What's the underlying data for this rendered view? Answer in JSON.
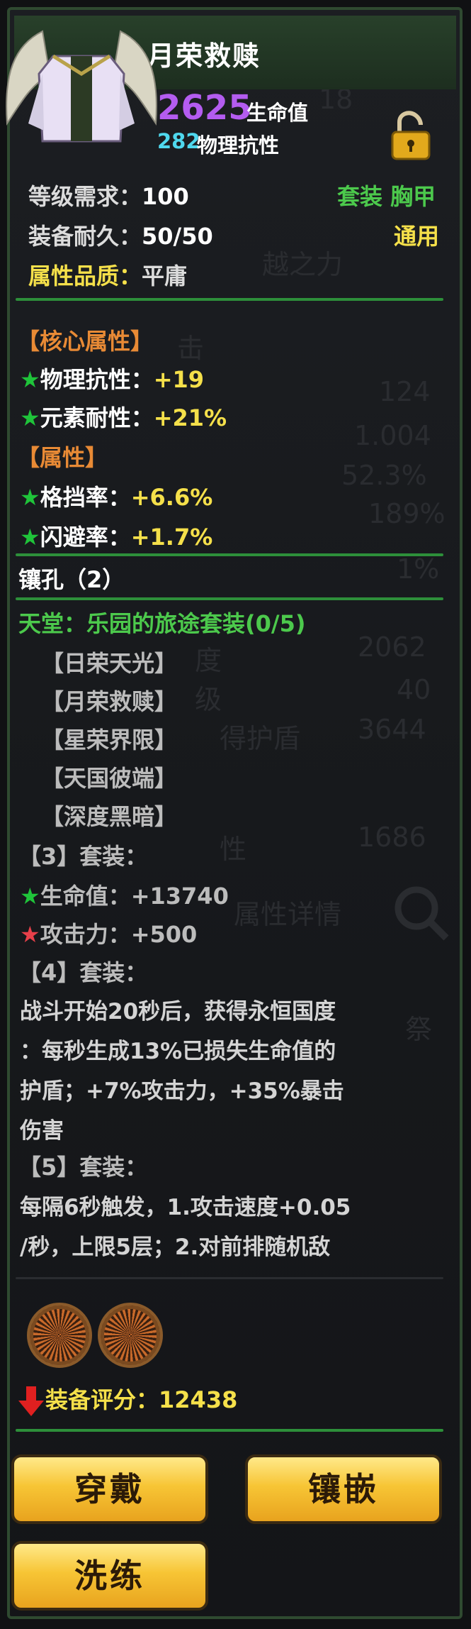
{
  "header": {
    "title": "月荣救赎",
    "hp_value": "2625",
    "hp_label": "生命值",
    "defense_value": "282",
    "defense_label": "物理抗性",
    "item_icon": "winged-armor-icon",
    "lock_icon": "unlocked-padlock-icon"
  },
  "info": {
    "level_label": "等级需求：",
    "level_value": "100",
    "type_label": "套装 胸甲",
    "durability_label": "装备耐久：",
    "durability_value": "50/50",
    "usage_label": "通用",
    "quality_label": "属性品质：",
    "quality_value": "平庸"
  },
  "core": {
    "header": "【核心属性】",
    "stats": [
      {
        "name": "物理抗性：",
        "value": "+19"
      },
      {
        "name": "元素耐性：",
        "value": "+21%"
      }
    ]
  },
  "attrs": {
    "header": "【属性】",
    "stats": [
      {
        "name": "格挡率：",
        "value": "+6.6%"
      },
      {
        "name": "闪避率：",
        "value": "+1.7%"
      }
    ]
  },
  "sockets": {
    "label": "镶孔（2）",
    "count": 2
  },
  "set": {
    "name": "天堂：乐园的旅途套装(0/5)",
    "pieces": [
      "【日荣天光】",
      "【月荣救赎】",
      "【星荣界限】",
      "【天国彼端】",
      "【深度黑暗】"
    ],
    "bonus3_label": "【3】套装：",
    "bonus3_lines": [
      {
        "text": "生命值：+13740"
      },
      {
        "text": "攻击力：+500"
      }
    ],
    "bonus4_label": "【4】套装：",
    "bonus4_lines": [
      "战斗开始20秒后，获得永恒国度",
      "：每秒生成13%已损失生命值的",
      "护盾；+7%攻击力，+35%暴击",
      "伤害"
    ],
    "bonus5_label": "【5】套装：",
    "bonus5_lines": [
      "每隔6秒触发，1.攻击速度+0.05",
      "/秒，上限5层；2.对前排随机敌"
    ]
  },
  "rating": {
    "label": "装备评分：",
    "value": "12438",
    "arrow_icon": "down-arrow-icon"
  },
  "buttons": {
    "wear": "穿戴",
    "inlay": "镶嵌",
    "refine": "洗练"
  },
  "background": {
    "ghost_numbers": [
      "18",
      "124",
      "1.004",
      "52.3%",
      "189%",
      "1%",
      "2062",
      "40",
      "3644",
      "1686"
    ],
    "ghost_words": [
      "越之力",
      "击",
      "度",
      "级",
      "得护盾",
      "性",
      "属性详情",
      "祭"
    ]
  },
  "colors": {
    "accent_green": "#2d8f3a",
    "purple": "#b45cf0",
    "cyan": "#4fd8ee",
    "yellow": "#f5e04a",
    "orange": "#e88a35",
    "button_gold": "#f7c535"
  }
}
